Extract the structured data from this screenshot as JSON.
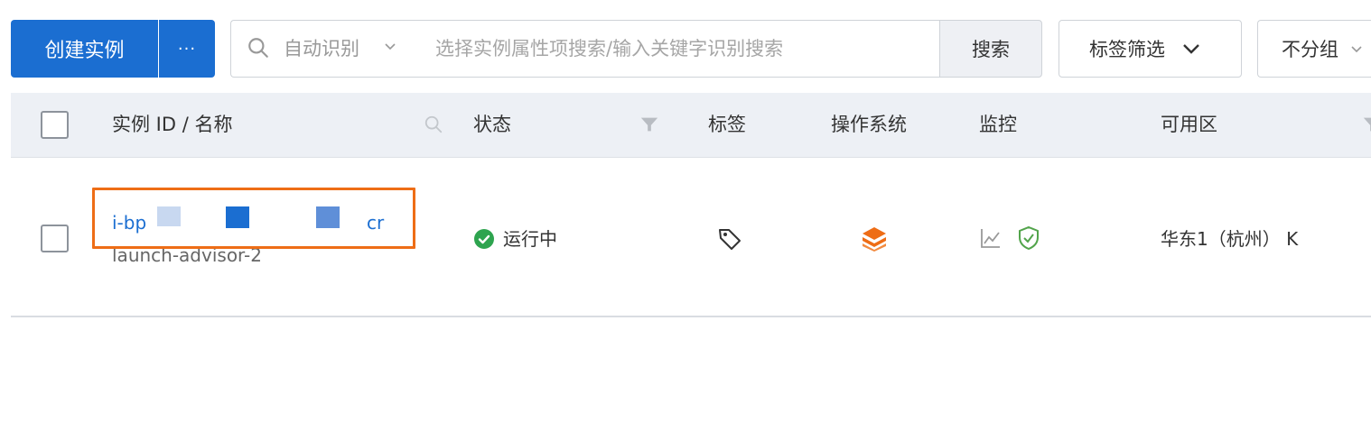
{
  "toolbar": {
    "create_label": "创建实例",
    "more_label": "···",
    "search_mode": "自动识别",
    "search_placeholder": "选择实例属性项搜索/输入关键字识别搜索",
    "search_button": "搜索",
    "tag_filter_label": "标签筛选",
    "group_label": "不分组"
  },
  "table": {
    "columns": [
      "实例 ID / 名称",
      "状态",
      "标签",
      "操作系统",
      "监控",
      "可用区"
    ],
    "rows": [
      {
        "id_prefix": "i-bp",
        "id_suffix": "cr",
        "name": "launch-advisor-2",
        "status": "运行中",
        "zone": "华东1（杭州） K"
      }
    ]
  },
  "colors": {
    "primary": "#1b6ed1",
    "highlight": "#ee6d16",
    "running": "#2ea44f",
    "os_icon": "#ee6d16",
    "monitor_ok": "#52a44b"
  }
}
